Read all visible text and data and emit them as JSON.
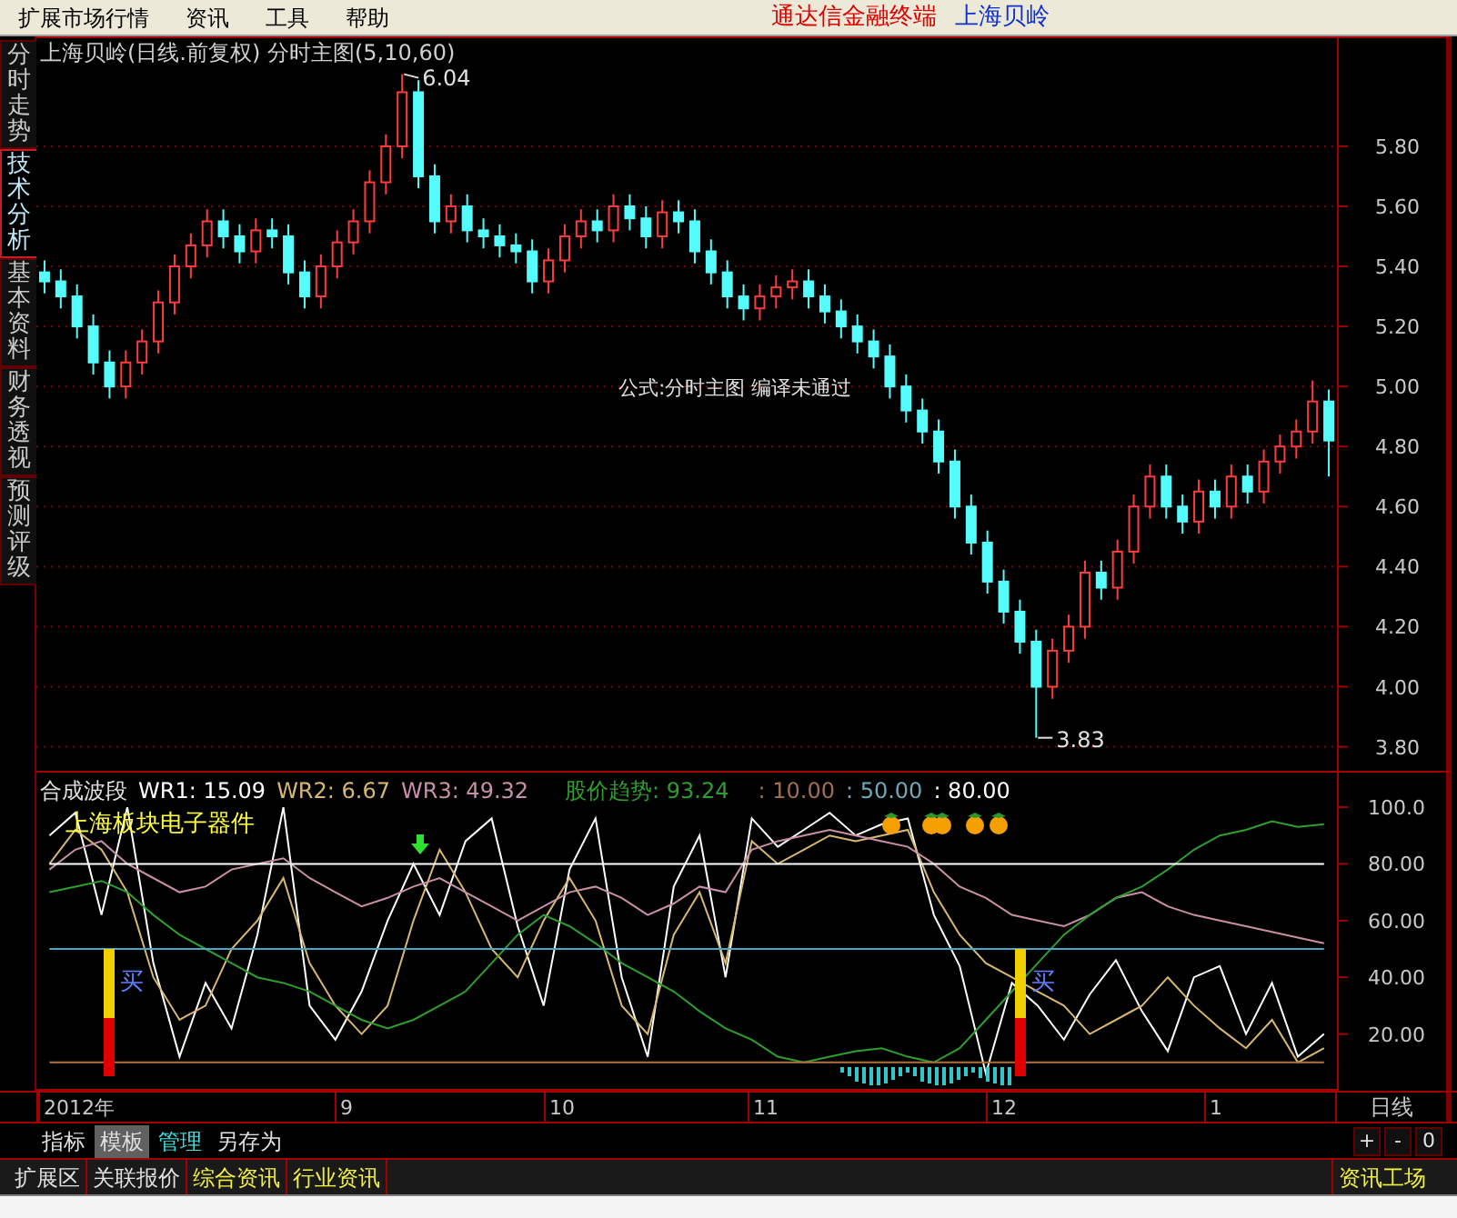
{
  "menu": {
    "items": [
      "扩展市场行情",
      "资讯",
      "工具",
      "帮助"
    ],
    "terminal_name": "通达信金融终端",
    "stock_name": "上海贝岭"
  },
  "side_tabs": [
    {
      "label": "分时走势",
      "selected": false
    },
    {
      "label": "技术分析",
      "selected": true
    },
    {
      "label": "基本资料",
      "selected": false
    },
    {
      "label": "财务透视",
      "selected": false
    },
    {
      "label": "预测评级",
      "selected": false
    }
  ],
  "price_chart": {
    "title": "上海贝岭(日线.前复权) 分时主图(5,10,60)",
    "high_label": "6.04",
    "low_label": "3.83",
    "message": "公式:分时主图 编译未通过",
    "chart_data": {
      "type": "candlestick",
      "ylim": [
        3.72,
        6.16
      ],
      "grid": true,
      "yticks": [
        {
          "value": 5.8,
          "label": "5.80"
        },
        {
          "value": 5.6,
          "label": "5.60"
        },
        {
          "value": 5.4,
          "label": "5.40"
        },
        {
          "value": 5.2,
          "label": "5.20"
        },
        {
          "value": 5.0,
          "label": "5.00"
        },
        {
          "value": 4.8,
          "label": "4.80"
        },
        {
          "value": 4.6,
          "label": "4.60"
        },
        {
          "value": 4.4,
          "label": "4.40"
        },
        {
          "value": 4.2,
          "label": "4.20"
        },
        {
          "value": 4.0,
          "label": "4.00"
        },
        {
          "value": 3.8,
          "label": "3.80"
        }
      ],
      "ohlc": [
        [
          5.38,
          5.42,
          5.31,
          5.35
        ],
        [
          5.35,
          5.39,
          5.26,
          5.3
        ],
        [
          5.3,
          5.34,
          5.16,
          5.2
        ],
        [
          5.2,
          5.24,
          5.04,
          5.08
        ],
        [
          5.08,
          5.12,
          4.96,
          5.0
        ],
        [
          5.0,
          5.12,
          4.96,
          5.08
        ],
        [
          5.08,
          5.19,
          5.04,
          5.15
        ],
        [
          5.15,
          5.32,
          5.11,
          5.28
        ],
        [
          5.28,
          5.44,
          5.24,
          5.4
        ],
        [
          5.4,
          5.51,
          5.36,
          5.47
        ],
        [
          5.47,
          5.59,
          5.43,
          5.55
        ],
        [
          5.55,
          5.59,
          5.46,
          5.5
        ],
        [
          5.5,
          5.54,
          5.41,
          5.45
        ],
        [
          5.45,
          5.56,
          5.41,
          5.52
        ],
        [
          5.52,
          5.56,
          5.46,
          5.5
        ],
        [
          5.5,
          5.54,
          5.34,
          5.38
        ],
        [
          5.38,
          5.42,
          5.26,
          5.3
        ],
        [
          5.3,
          5.44,
          5.26,
          5.4
        ],
        [
          5.4,
          5.52,
          5.36,
          5.48
        ],
        [
          5.48,
          5.59,
          5.44,
          5.55
        ],
        [
          5.55,
          5.72,
          5.51,
          5.68
        ],
        [
          5.68,
          5.84,
          5.64,
          5.8
        ],
        [
          5.8,
          6.04,
          5.76,
          5.98
        ],
        [
          5.98,
          6.02,
          5.66,
          5.7
        ],
        [
          5.7,
          5.74,
          5.51,
          5.55
        ],
        [
          5.55,
          5.64,
          5.51,
          5.6
        ],
        [
          5.6,
          5.64,
          5.48,
          5.52
        ],
        [
          5.52,
          5.56,
          5.46,
          5.5
        ],
        [
          5.5,
          5.54,
          5.43,
          5.47
        ],
        [
          5.47,
          5.51,
          5.41,
          5.45
        ],
        [
          5.45,
          5.49,
          5.31,
          5.35
        ],
        [
          5.35,
          5.46,
          5.31,
          5.42
        ],
        [
          5.42,
          5.54,
          5.38,
          5.5
        ],
        [
          5.5,
          5.59,
          5.46,
          5.55
        ],
        [
          5.55,
          5.59,
          5.48,
          5.52
        ],
        [
          5.52,
          5.64,
          5.48,
          5.6
        ],
        [
          5.6,
          5.64,
          5.52,
          5.56
        ],
        [
          5.56,
          5.6,
          5.46,
          5.5
        ],
        [
          5.5,
          5.62,
          5.46,
          5.58
        ],
        [
          5.58,
          5.62,
          5.51,
          5.55
        ],
        [
          5.55,
          5.59,
          5.41,
          5.45
        ],
        [
          5.45,
          5.49,
          5.34,
          5.38
        ],
        [
          5.38,
          5.42,
          5.26,
          5.3
        ],
        [
          5.3,
          5.34,
          5.22,
          5.26
        ],
        [
          5.26,
          5.34,
          5.22,
          5.3
        ],
        [
          5.3,
          5.37,
          5.26,
          5.33
        ],
        [
          5.33,
          5.39,
          5.29,
          5.35
        ],
        [
          5.35,
          5.39,
          5.26,
          5.3
        ],
        [
          5.3,
          5.34,
          5.21,
          5.25
        ],
        [
          5.25,
          5.29,
          5.16,
          5.2
        ],
        [
          5.2,
          5.24,
          5.11,
          5.15
        ],
        [
          5.15,
          5.19,
          5.06,
          5.1
        ],
        [
          5.1,
          5.14,
          4.96,
          5.0
        ],
        [
          5.0,
          5.04,
          4.88,
          4.92
        ],
        [
          4.92,
          4.96,
          4.81,
          4.85
        ],
        [
          4.85,
          4.89,
          4.71,
          4.75
        ],
        [
          4.75,
          4.79,
          4.56,
          4.6
        ],
        [
          4.6,
          4.64,
          4.44,
          4.48
        ],
        [
          4.48,
          4.52,
          4.31,
          4.35
        ],
        [
          4.35,
          4.39,
          4.21,
          4.25
        ],
        [
          4.25,
          4.29,
          4.11,
          4.15
        ],
        [
          4.15,
          4.19,
          3.83,
          4.0
        ],
        [
          4.0,
          4.16,
          3.96,
          4.12
        ],
        [
          4.12,
          4.24,
          4.08,
          4.2
        ],
        [
          4.2,
          4.42,
          4.16,
          4.38
        ],
        [
          4.38,
          4.42,
          4.29,
          4.33
        ],
        [
          4.33,
          4.49,
          4.29,
          4.45
        ],
        [
          4.45,
          4.64,
          4.41,
          4.6
        ],
        [
          4.6,
          4.74,
          4.56,
          4.7
        ],
        [
          4.7,
          4.74,
          4.56,
          4.6
        ],
        [
          4.6,
          4.64,
          4.51,
          4.55
        ],
        [
          4.55,
          4.69,
          4.51,
          4.65
        ],
        [
          4.65,
          4.69,
          4.56,
          4.6
        ],
        [
          4.6,
          4.74,
          4.56,
          4.7
        ],
        [
          4.7,
          4.74,
          4.61,
          4.65
        ],
        [
          4.65,
          4.79,
          4.61,
          4.75
        ],
        [
          4.75,
          4.84,
          4.71,
          4.8
        ],
        [
          4.8,
          4.89,
          4.76,
          4.85
        ],
        [
          4.85,
          5.02,
          4.81,
          4.95
        ],
        [
          4.95,
          4.99,
          4.7,
          4.82
        ]
      ]
    }
  },
  "indicator": {
    "name": "合成波段",
    "values": [
      {
        "label": "WR1: 15.09",
        "color": "#ffffff"
      },
      {
        "label": "WR2: 6.67",
        "color": "#d8b870"
      },
      {
        "label": "WR3: 49.32",
        "color": "#c890a8"
      },
      {
        "label": "股价趋势: 93.24",
        "color": "#2e9e2e"
      },
      {
        "label": ": 10.00",
        "color": "#a0704c"
      },
      {
        "label": ": 50.00",
        "color": "#70a8b8"
      },
      {
        "label": ": 80.00",
        "color": "#ffffff"
      }
    ],
    "sector_label": "上海板块电子器件",
    "buy_signals": [
      "买",
      "买"
    ],
    "chart_data": {
      "type": "line",
      "ylim": [
        0,
        100
      ],
      "yticks": [
        {
          "value": 100,
          "label": "100.0"
        },
        {
          "value": 80,
          "label": "80.00"
        },
        {
          "value": 60,
          "label": "60.00"
        },
        {
          "value": 40,
          "label": "40.00"
        },
        {
          "value": 20,
          "label": "20.00"
        }
      ],
      "series": [
        {
          "color": "#ffffff",
          "values": [
            90,
            98,
            62,
            100,
            45,
            12,
            38,
            22,
            55,
            100,
            30,
            18,
            35,
            60,
            80,
            62,
            88,
            96,
            58,
            30,
            78,
            96,
            40,
            12,
            72,
            90,
            40,
            96,
            86,
            92,
            98,
            90,
            94,
            96,
            62,
            44,
            6,
            38,
            30,
            18,
            34,
            46,
            28,
            14,
            40,
            44,
            20,
            38,
            12,
            20
          ]
        },
        {
          "color": "#d8b870",
          "values": [
            80,
            92,
            85,
            70,
            40,
            25,
            30,
            50,
            60,
            75,
            45,
            30,
            20,
            30,
            60,
            85,
            70,
            50,
            40,
            60,
            75,
            60,
            30,
            20,
            55,
            70,
            45,
            88,
            80,
            85,
            90,
            88,
            90,
            92,
            70,
            55,
            45,
            40,
            35,
            30,
            20,
            25,
            30,
            40,
            30,
            22,
            15,
            25,
            10,
            15
          ]
        },
        {
          "color": "#c890a8",
          "values": [
            78,
            85,
            88,
            80,
            75,
            70,
            72,
            78,
            80,
            82,
            75,
            70,
            65,
            68,
            72,
            75,
            70,
            65,
            60,
            65,
            70,
            72,
            68,
            62,
            66,
            72,
            70,
            85,
            88,
            90,
            92,
            90,
            88,
            86,
            80,
            72,
            68,
            62,
            60,
            58,
            62,
            68,
            70,
            65,
            62,
            60,
            58,
            56,
            54,
            52
          ]
        },
        {
          "color": "#2e9e2e",
          "values": [
            70,
            72,
            74,
            70,
            62,
            55,
            50,
            45,
            40,
            38,
            35,
            30,
            25,
            22,
            25,
            30,
            35,
            45,
            55,
            62,
            58,
            52,
            45,
            40,
            35,
            28,
            22,
            18,
            12,
            10,
            12,
            14,
            15,
            12,
            10,
            15,
            25,
            35,
            45,
            55,
            62,
            68,
            72,
            78,
            85,
            90,
            92,
            95,
            93,
            94
          ]
        },
        {
          "color": "#b07040",
          "values": [
            10,
            10,
            10,
            10,
            10,
            10,
            10,
            10,
            10,
            10,
            10,
            10,
            10,
            10,
            10,
            10,
            10,
            10,
            10,
            10,
            10,
            10,
            10,
            10,
            10,
            10,
            10,
            10,
            10,
            10,
            10,
            10,
            10,
            10,
            10,
            10,
            10,
            10,
            10,
            10,
            10,
            10,
            10,
            10,
            10,
            10,
            10,
            10,
            10,
            10
          ]
        },
        {
          "color": "#4aa8c0",
          "values": [
            50,
            50,
            50,
            50,
            50,
            50,
            50,
            50,
            50,
            50,
            50,
            50,
            50,
            50,
            50,
            50,
            50,
            50,
            50,
            50,
            50,
            50,
            50,
            50,
            50,
            50,
            50,
            50,
            50,
            50,
            50,
            50,
            50,
            50,
            50,
            50,
            50,
            50,
            50,
            50,
            50,
            50,
            50,
            50,
            50,
            50,
            50,
            50,
            50,
            50
          ]
        },
        {
          "color": "#ffffff",
          "values": [
            80,
            80,
            80,
            80,
            80,
            80,
            80,
            80,
            80,
            80,
            80,
            80,
            80,
            80,
            80,
            80,
            80,
            80,
            80,
            80,
            80,
            80,
            80,
            80,
            80,
            80,
            80,
            80,
            80,
            80,
            80,
            80,
            80,
            80,
            80,
            80,
            80,
            80,
            80,
            80,
            80,
            80,
            80,
            80,
            80,
            80,
            80,
            80,
            80,
            80
          ]
        }
      ]
    }
  },
  "date_axis": {
    "labels": [
      "2012年",
      "9",
      "10",
      "11",
      "12",
      "1"
    ],
    "period": "日线"
  },
  "toolbar": {
    "tabs": [
      {
        "label": "指标",
        "selected": false,
        "highlighted": false
      },
      {
        "label": "模板",
        "selected": true,
        "highlighted": false
      },
      {
        "label": "管理",
        "selected": false,
        "highlighted": true
      },
      {
        "label": "另存为",
        "selected": false,
        "highlighted": false
      }
    ],
    "zoom_buttons": [
      "+",
      "-",
      "0"
    ]
  },
  "bottom_tabs": [
    {
      "label": "扩展区",
      "highlighted": false
    },
    {
      "label": "关联报价",
      "highlighted": false
    },
    {
      "label": "综合资讯",
      "highlighted": true
    },
    {
      "label": "行业资讯",
      "highlighted": true
    }
  ],
  "bottom_right_tab": {
    "label": "资讯工场",
    "highlighted": true
  }
}
